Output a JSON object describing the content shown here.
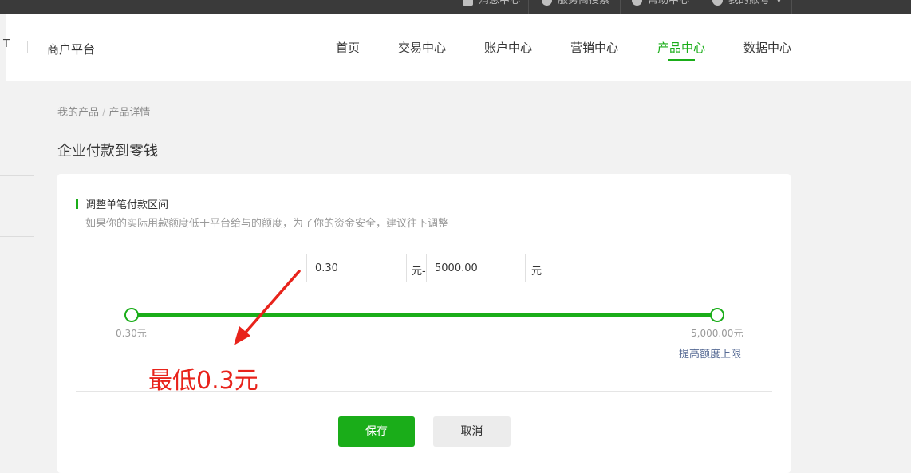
{
  "topbar": {
    "items": [
      {
        "label": "消息中心",
        "icon": "message-icon"
      },
      {
        "label": "服务商搜索",
        "icon": "search-icon"
      },
      {
        "label": "帮助中心",
        "icon": "help-icon"
      },
      {
        "label": "我的账号",
        "icon": "user-icon"
      }
    ]
  },
  "header": {
    "logo_stub": "T",
    "platform_name": "商户平台",
    "nav": [
      {
        "label": "首页"
      },
      {
        "label": "交易中心"
      },
      {
        "label": "账户中心"
      },
      {
        "label": "营销中心"
      },
      {
        "label": "产品中心",
        "active": true
      },
      {
        "label": "数据中心"
      }
    ]
  },
  "breadcrumb": {
    "parent": "我的产品",
    "separator": "/",
    "current": "产品详情"
  },
  "page_title": "企业付款到零钱",
  "section": {
    "title": "调整单笔付款区间",
    "description": "如果你的实际用款额度低于平台给与的额度，为了你的资金安全，建议往下调整"
  },
  "range": {
    "min_value": "0.30",
    "min_unit": "元-",
    "max_value": "5000.00",
    "max_unit": "元",
    "slider_min_label": "0.30元",
    "slider_max_label": "5,000.00元",
    "raise_limit_link": "提高额度上限"
  },
  "buttons": {
    "save": "保存",
    "cancel": "取消"
  },
  "annotation": {
    "text": "最低0.3元",
    "color": "#e8231b"
  },
  "colors": {
    "accent": "#1aad19",
    "link": "#576b95",
    "topbar": "#3a3a3a"
  }
}
